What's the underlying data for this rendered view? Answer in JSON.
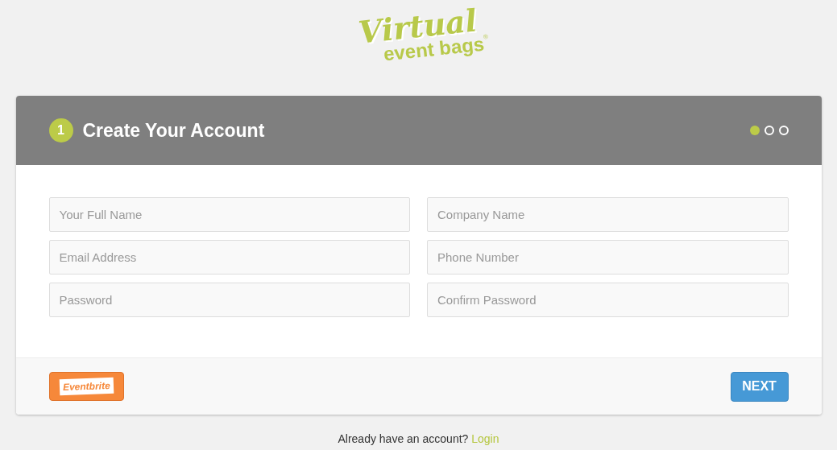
{
  "logo": {
    "line_1": "Virtual",
    "line_2": "event bags",
    "mark": "®"
  },
  "header": {
    "step_number": "1",
    "title": "Create Your Account",
    "steps": [
      {
        "selected": true
      },
      {
        "selected": false
      },
      {
        "selected": false
      }
    ]
  },
  "fields": [
    {
      "placeholder": "Your Full Name"
    },
    {
      "placeholder": "Company Name"
    },
    {
      "placeholder": "Email Address"
    },
    {
      "placeholder": "Phone Number"
    },
    {
      "placeholder": "Password"
    },
    {
      "placeholder": "Confirm Password"
    }
  ],
  "footer": {
    "eventbrite_button": "Eventbrite",
    "next_button": "NEXT"
  },
  "login_prompt": {
    "text": "Already have an account?",
    "link": "Login"
  }
}
